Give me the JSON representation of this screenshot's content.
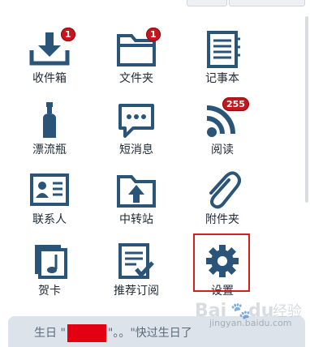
{
  "grid": [
    {
      "name": "inbox",
      "label": "收件箱",
      "icon": "inbox-download-icon",
      "badge": "1"
    },
    {
      "name": "folders",
      "label": "文件夹",
      "icon": "folder-icon",
      "badge": "1"
    },
    {
      "name": "notes",
      "label": "记事本",
      "icon": "notebook-icon",
      "badge": null
    },
    {
      "name": "drift-bottle",
      "label": "漂流瓶",
      "icon": "bottle-icon",
      "badge": null
    },
    {
      "name": "sms",
      "label": "短消息",
      "icon": "chat-bubble-icon",
      "badge": null
    },
    {
      "name": "reader",
      "label": "阅读",
      "icon": "rss-icon",
      "badge": "255"
    },
    {
      "name": "contacts",
      "label": "联系人",
      "icon": "contact-card-icon",
      "badge": null
    },
    {
      "name": "transfer",
      "label": "中转站",
      "icon": "folder-upload-icon",
      "badge": null
    },
    {
      "name": "attachments",
      "label": "附件夹",
      "icon": "paperclip-icon",
      "badge": null
    },
    {
      "name": "cards",
      "label": "贺卡",
      "icon": "music-card-icon",
      "badge": null
    },
    {
      "name": "subscriptions",
      "label": "推荐订阅",
      "icon": "checklist-icon",
      "badge": null
    },
    {
      "name": "settings",
      "label": "设置",
      "icon": "gear-icon",
      "badge": null
    }
  ],
  "bottom": {
    "prefix": "生日 \"",
    "suffix": "\"。。\"快过生日了"
  },
  "watermark": {
    "brand": "Bai du 经验",
    "url": "jingyan.baidu.com"
  },
  "colors": {
    "icon": "#2a5478",
    "badge": "#c4161c",
    "highlight": "#d41f1f",
    "bottom_bar": "#dce3ea"
  }
}
